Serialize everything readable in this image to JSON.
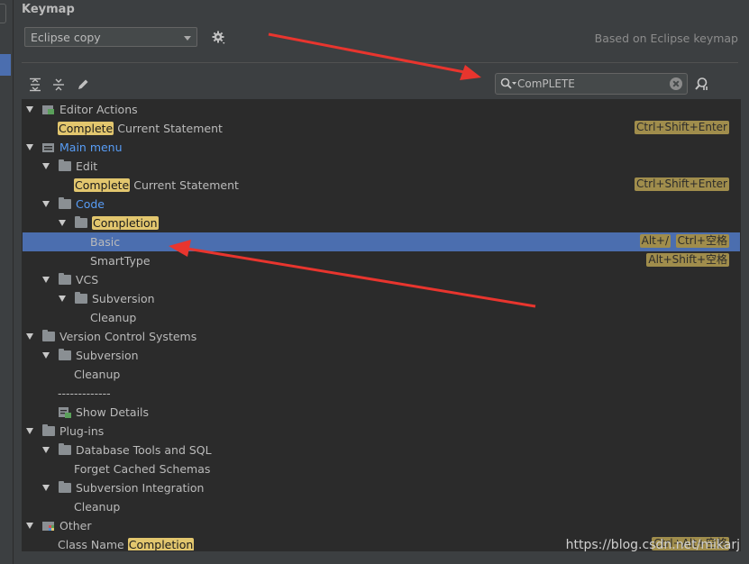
{
  "panel": {
    "title": "Keymap"
  },
  "keymap_select": {
    "value": "Eclipse copy"
  },
  "based_on": "Based on Eclipse keymap",
  "search": {
    "value": "ComPLETE"
  },
  "tree": [
    {
      "label_parts": [
        {
          "t": "Editor Actions"
        }
      ],
      "depth": 0,
      "expanded": true,
      "icon": "editor-actions-icon",
      "shortcuts": []
    },
    {
      "label_parts": [
        {
          "t": "Complete",
          "hl": true
        },
        {
          "t": " Current Statement"
        }
      ],
      "depth": 1,
      "expanded": null,
      "icon": null,
      "shortcuts": [
        "Ctrl+Shift+Enter"
      ]
    },
    {
      "label_parts": [
        {
          "t": "Main menu"
        }
      ],
      "depth": 0,
      "expanded": true,
      "icon": "main-menu-icon",
      "blue": true,
      "shortcuts": []
    },
    {
      "label_parts": [
        {
          "t": "Edit"
        }
      ],
      "depth": 1,
      "expanded": true,
      "icon": "folder-icon",
      "shortcuts": []
    },
    {
      "label_parts": [
        {
          "t": "Complete",
          "hl": true
        },
        {
          "t": " Current Statement"
        }
      ],
      "depth": 2,
      "expanded": null,
      "icon": null,
      "shortcuts": [
        "Ctrl+Shift+Enter"
      ]
    },
    {
      "label_parts": [
        {
          "t": "Code"
        }
      ],
      "depth": 1,
      "expanded": true,
      "icon": "folder-icon",
      "blue": true,
      "shortcuts": []
    },
    {
      "label_parts": [
        {
          "t": "Completion",
          "hl": true
        }
      ],
      "depth": 2,
      "expanded": true,
      "icon": "folder-icon",
      "shortcuts": []
    },
    {
      "label_parts": [
        {
          "t": "Basic"
        }
      ],
      "depth": 3,
      "expanded": null,
      "icon": null,
      "selected": true,
      "shortcuts": [
        "Ctrl+空格",
        "Alt+/"
      ]
    },
    {
      "label_parts": [
        {
          "t": "SmartType"
        }
      ],
      "depth": 3,
      "expanded": null,
      "icon": null,
      "shortcuts": [
        "Alt+Shift+空格"
      ]
    },
    {
      "label_parts": [
        {
          "t": "VCS"
        }
      ],
      "depth": 1,
      "expanded": true,
      "icon": "folder-icon",
      "shortcuts": []
    },
    {
      "label_parts": [
        {
          "t": "Subversion"
        }
      ],
      "depth": 2,
      "expanded": true,
      "icon": "folder-icon",
      "shortcuts": []
    },
    {
      "label_parts": [
        {
          "t": "Cleanup"
        }
      ],
      "depth": 3,
      "expanded": null,
      "icon": null,
      "shortcuts": []
    },
    {
      "label_parts": [
        {
          "t": "Version Control Systems"
        }
      ],
      "depth": 0,
      "expanded": true,
      "icon": "folder-icon",
      "shortcuts": []
    },
    {
      "label_parts": [
        {
          "t": "Subversion"
        }
      ],
      "depth": 1,
      "expanded": true,
      "icon": "folder-icon",
      "shortcuts": []
    },
    {
      "label_parts": [
        {
          "t": "Cleanup"
        }
      ],
      "depth": 2,
      "expanded": null,
      "icon": null,
      "shortcuts": []
    },
    {
      "label_parts": [
        {
          "t": "-------------"
        }
      ],
      "depth": 1,
      "expanded": null,
      "icon": null,
      "shortcuts": []
    },
    {
      "label_parts": [
        {
          "t": "Show Details"
        }
      ],
      "depth": 1,
      "expanded": null,
      "icon": "show-details-icon",
      "shortcuts": []
    },
    {
      "label_parts": [
        {
          "t": "Plug-ins"
        }
      ],
      "depth": 0,
      "expanded": true,
      "icon": "folder-icon",
      "shortcuts": []
    },
    {
      "label_parts": [
        {
          "t": "Database Tools and SQL"
        }
      ],
      "depth": 1,
      "expanded": true,
      "icon": "folder-icon",
      "shortcuts": []
    },
    {
      "label_parts": [
        {
          "t": "Forget Cached Schemas"
        }
      ],
      "depth": 2,
      "expanded": null,
      "icon": null,
      "shortcuts": []
    },
    {
      "label_parts": [
        {
          "t": "Subversion Integration"
        }
      ],
      "depth": 1,
      "expanded": true,
      "icon": "folder-icon",
      "shortcuts": []
    },
    {
      "label_parts": [
        {
          "t": "Cleanup"
        }
      ],
      "depth": 2,
      "expanded": null,
      "icon": null,
      "shortcuts": []
    },
    {
      "label_parts": [
        {
          "t": "Other"
        }
      ],
      "depth": 0,
      "expanded": true,
      "icon": "other-icon",
      "shortcuts": []
    },
    {
      "label_parts": [
        {
          "t": "Class Name "
        },
        {
          "t": "Completion",
          "hl": true
        }
      ],
      "depth": 1,
      "expanded": null,
      "icon": null,
      "shortcuts": [
        "Ctrl+Alt+空格"
      ]
    }
  ],
  "watermark": "https://blog.csdn.net/mikarj",
  "colors": {
    "selection": "#4b6eaf",
    "highlight": "#e2c66e",
    "shortcut": "#a08d4c",
    "link": "#589df6",
    "arrow": "#e8352e"
  }
}
